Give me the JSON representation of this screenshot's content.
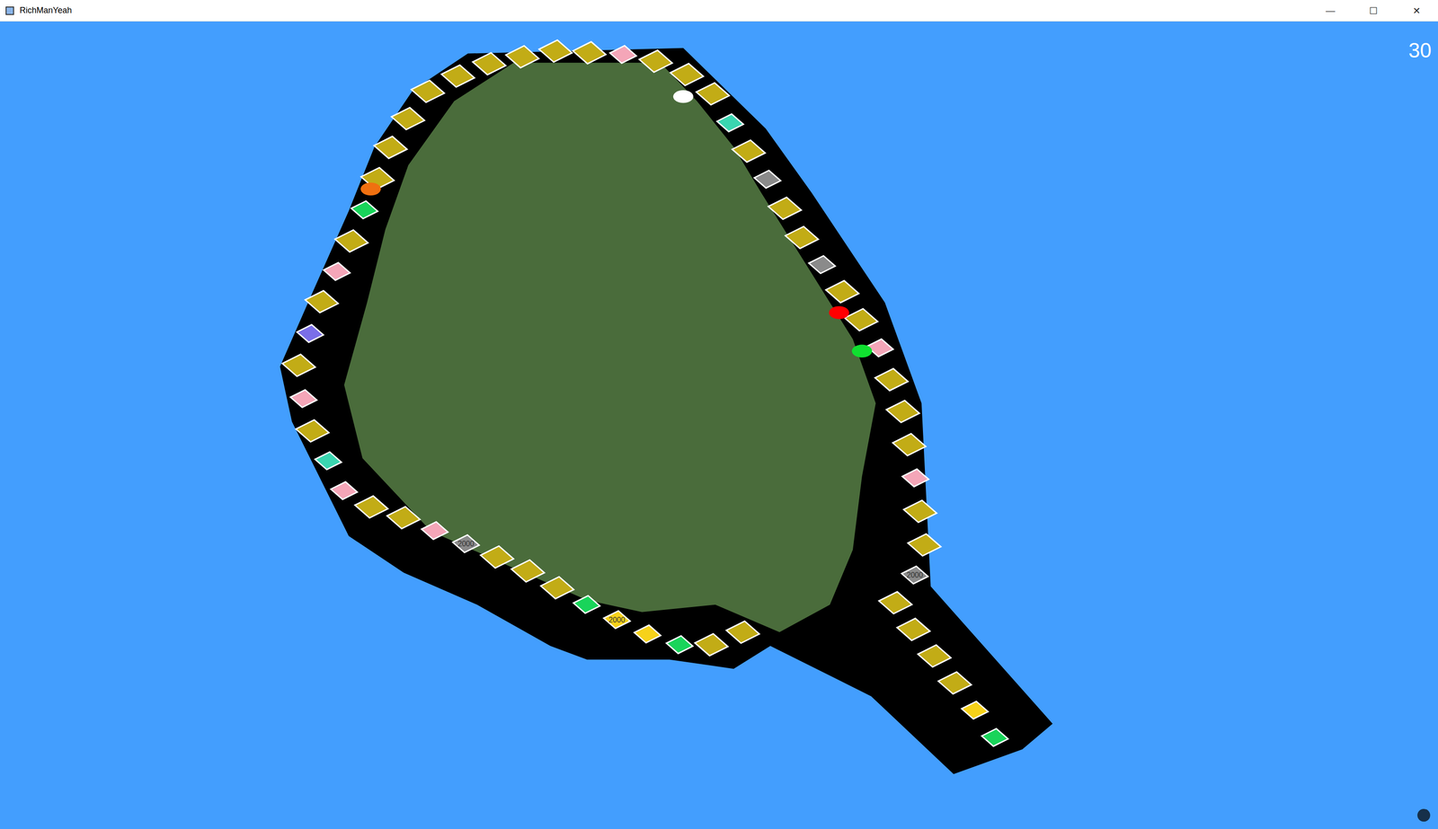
{
  "window": {
    "title": "RichManYeah",
    "controls": [
      "—",
      "☐",
      "✕"
    ]
  },
  "hud": {
    "counter": "30"
  },
  "tiles": [
    {
      "kind": "special",
      "color": "#19d45a",
      "label": ""
    },
    {
      "kind": "special",
      "color": "#f6d21a",
      "label": ""
    },
    {
      "kind": "property",
      "color": "#c2ac16",
      "label": ""
    },
    {
      "kind": "property",
      "color": "#c2ac16",
      "label": ""
    },
    {
      "kind": "property",
      "color": "#c2ac16",
      "label": ""
    },
    {
      "kind": "property",
      "color": "#c2ac16",
      "label": ""
    },
    {
      "kind": "special",
      "color": "#8a8a8a",
      "label": "2000"
    },
    {
      "kind": "property",
      "color": "#c2ac16",
      "label": ""
    },
    {
      "kind": "property",
      "color": "#c2ac16",
      "label": ""
    },
    {
      "kind": "special",
      "color": "#f4a6b8",
      "label": ""
    },
    {
      "kind": "property",
      "color": "#c2ac16",
      "label": ""
    },
    {
      "kind": "property",
      "color": "#c2ac16",
      "label": ""
    },
    {
      "kind": "property",
      "color": "#c2ac16",
      "label": ""
    },
    {
      "kind": "special",
      "color": "#f4a6b8",
      "label": ""
    },
    {
      "kind": "property",
      "color": "#c2ac16",
      "label": ""
    },
    {
      "kind": "property",
      "color": "#c2ac16",
      "label": ""
    },
    {
      "kind": "special",
      "color": "#8a8a8a",
      "label": ""
    },
    {
      "kind": "property",
      "color": "#c2ac16",
      "label": ""
    },
    {
      "kind": "property",
      "color": "#c2ac16",
      "label": ""
    },
    {
      "kind": "special",
      "color": "#8a8a8a",
      "label": ""
    },
    {
      "kind": "property",
      "color": "#c2ac16",
      "label": ""
    },
    {
      "kind": "special",
      "color": "#3ad6b0",
      "label": ""
    },
    {
      "kind": "property",
      "color": "#c2ac16",
      "label": ""
    },
    {
      "kind": "property",
      "color": "#c2ac16",
      "label": ""
    },
    {
      "kind": "property",
      "color": "#c2ac16",
      "label": ""
    },
    {
      "kind": "special",
      "color": "#f4a6b8",
      "label": ""
    },
    {
      "kind": "property",
      "color": "#c2ac16",
      "label": ""
    },
    {
      "kind": "property",
      "color": "#c2ac16",
      "label": ""
    },
    {
      "kind": "property",
      "color": "#c2ac16",
      "label": ""
    },
    {
      "kind": "property",
      "color": "#c2ac16",
      "label": ""
    },
    {
      "kind": "property",
      "color": "#c2ac16",
      "label": ""
    },
    {
      "kind": "property",
      "color": "#c2ac16",
      "label": ""
    },
    {
      "kind": "property",
      "color": "#c2ac16",
      "label": ""
    },
    {
      "kind": "property",
      "color": "#c2ac16",
      "label": ""
    },
    {
      "kind": "property",
      "color": "#c2ac16",
      "label": ""
    },
    {
      "kind": "special",
      "color": "#19d45a",
      "label": ""
    },
    {
      "kind": "property",
      "color": "#c2ac16",
      "label": ""
    },
    {
      "kind": "special",
      "color": "#f4a6b8",
      "label": ""
    },
    {
      "kind": "property",
      "color": "#c2ac16",
      "label": ""
    },
    {
      "kind": "special",
      "color": "#7a6ee8",
      "label": ""
    },
    {
      "kind": "property",
      "color": "#c2ac16",
      "label": ""
    },
    {
      "kind": "special",
      "color": "#f4a6b8",
      "label": ""
    },
    {
      "kind": "property",
      "color": "#c2ac16",
      "label": ""
    },
    {
      "kind": "special",
      "color": "#3ad6b0",
      "label": ""
    },
    {
      "kind": "special",
      "color": "#f4a6b8",
      "label": ""
    },
    {
      "kind": "property",
      "color": "#c2ac16",
      "label": ""
    },
    {
      "kind": "property",
      "color": "#c2ac16",
      "label": ""
    },
    {
      "kind": "special",
      "color": "#f4a6b8",
      "label": ""
    },
    {
      "kind": "special",
      "color": "#8a8a8a",
      "label": "2000"
    },
    {
      "kind": "property",
      "color": "#c2ac16",
      "label": ""
    },
    {
      "kind": "property",
      "color": "#c2ac16",
      "label": ""
    },
    {
      "kind": "property",
      "color": "#c2ac16",
      "label": ""
    },
    {
      "kind": "special",
      "color": "#19d45a",
      "label": ""
    },
    {
      "kind": "special",
      "color": "#f6d21a",
      "label": "2000"
    },
    {
      "kind": "special",
      "color": "#f6d21a",
      "label": ""
    },
    {
      "kind": "special",
      "color": "#19d45a",
      "label": ""
    },
    {
      "kind": "property",
      "color": "#c2ac16",
      "label": ""
    },
    {
      "kind": "property",
      "color": "#c2ac16",
      "label": ""
    }
  ],
  "players": [
    {
      "color": "#ffffff"
    },
    {
      "color": "#f07010"
    },
    {
      "color": "#ff0000"
    },
    {
      "color": "#10e030"
    }
  ]
}
